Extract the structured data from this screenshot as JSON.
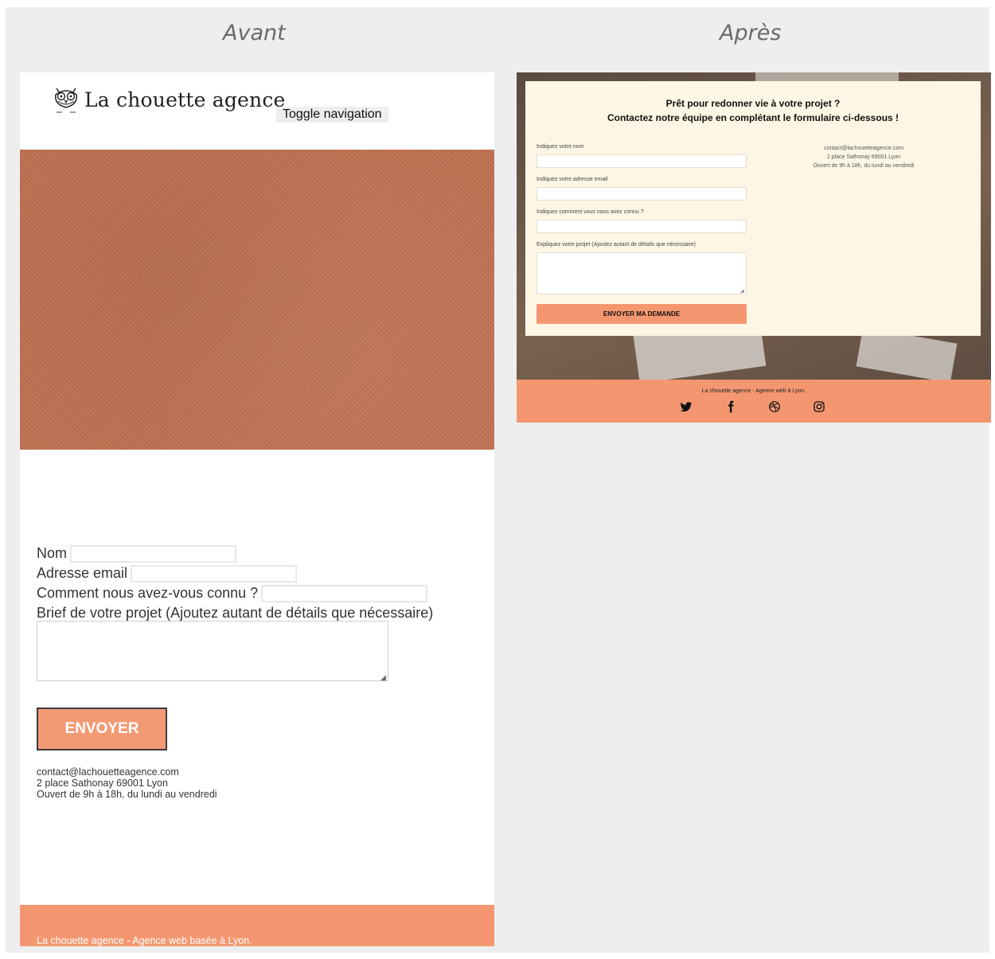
{
  "captions": {
    "before": "Avant",
    "after": "Après"
  },
  "before": {
    "logo_text": "La chouette agence",
    "toggle_nav_label": "Toggle navigation",
    "form": {
      "name_label": "Nom",
      "email_label": "Adresse email",
      "source_label": "Comment nous avez-vous connu ?",
      "brief_label": "Brief de votre projet (Ajoutez autant de détails que nécessaire)",
      "submit_label": "ENVOYER"
    },
    "contact": {
      "email": "contact@lachouetteagence.com",
      "address": "2 place Sathonay 69001 Lyon",
      "hours": "Ouvert de 9h à 18h, du lundi au vendredi"
    },
    "footer_text": "La chouette agence - Agence web basée à Lyon."
  },
  "after": {
    "title_line1": "Prêt pour redonner vie à votre projet ?",
    "title_line2": "Contactez notre équipe en complétant le formulaire ci-dessous !",
    "form": {
      "name_label": "Indiquez votre nom",
      "email_label": "Indiquez votre adresse email",
      "source_label": "Indiquez comment vous nous avez connu ?",
      "brief_label": "Expliquez votre projet (Ajoutez autant de détails que nécessaire)",
      "submit_label": "ENVOYER MA DEMANDE"
    },
    "contact": {
      "email": "contact@lachouetteagence.com",
      "address": "2 place Sathonay 69001 Lyon",
      "hours": "Ouvert de 9h à 18h, du lundi au vendredi"
    },
    "footer_text": "La chouette agence - Agence web à Lyon.",
    "social_icons": [
      "twitter-icon",
      "facebook-icon",
      "dribbble-icon",
      "instagram-icon"
    ]
  },
  "colors": {
    "accent": "#f49771",
    "hero_texture": "#c07051",
    "card_background": "#fef6e4",
    "board_background": "#eeeeee"
  }
}
